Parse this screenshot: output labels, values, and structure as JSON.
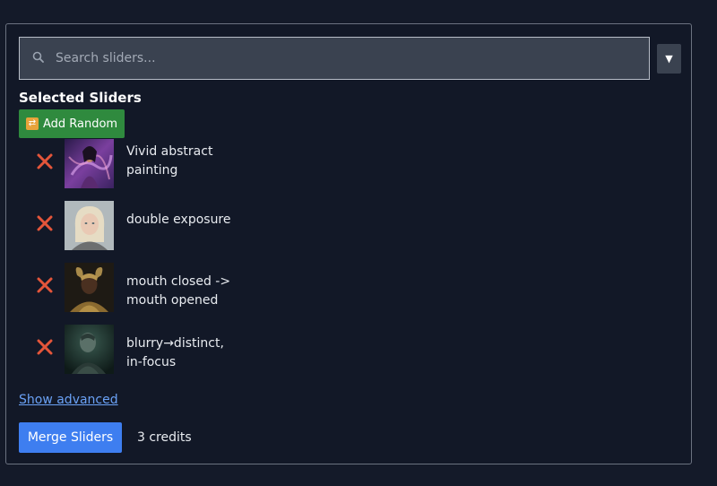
{
  "search": {
    "placeholder": "Search sliders...",
    "value": "",
    "icon": "search-icon",
    "dropdown_glyph": "▼"
  },
  "section": {
    "title": "Selected Sliders"
  },
  "add_random": {
    "label": "Add Random",
    "icon": "shuffle-icon",
    "color": "#2f8a3e"
  },
  "sliders": [
    {
      "label_line1": "Vivid abstract",
      "label_line2": "painting",
      "remove_icon": "close-icon",
      "thumbnail": "purple abstract portrait"
    },
    {
      "label_line1": "double exposure",
      "label_line2": "",
      "remove_icon": "close-icon",
      "thumbnail": "blonde woman portrait"
    },
    {
      "label_line1": "mouth closed ->",
      "label_line2": "mouth opened",
      "remove_icon": "close-icon",
      "thumbnail": "golden armored woman"
    },
    {
      "label_line1": "blurry→distinct,",
      "label_line2": "in-focus",
      "remove_icon": "close-icon",
      "thumbnail": "dark teal figure"
    }
  ],
  "advanced": {
    "label": "Show advanced"
  },
  "merge": {
    "label": "Merge Sliders",
    "color": "#3e7ef0"
  },
  "credits": {
    "text": "3 credits"
  },
  "colors": {
    "background": "#141a29",
    "remove": "#e4553a",
    "link": "#6aa1f5"
  }
}
